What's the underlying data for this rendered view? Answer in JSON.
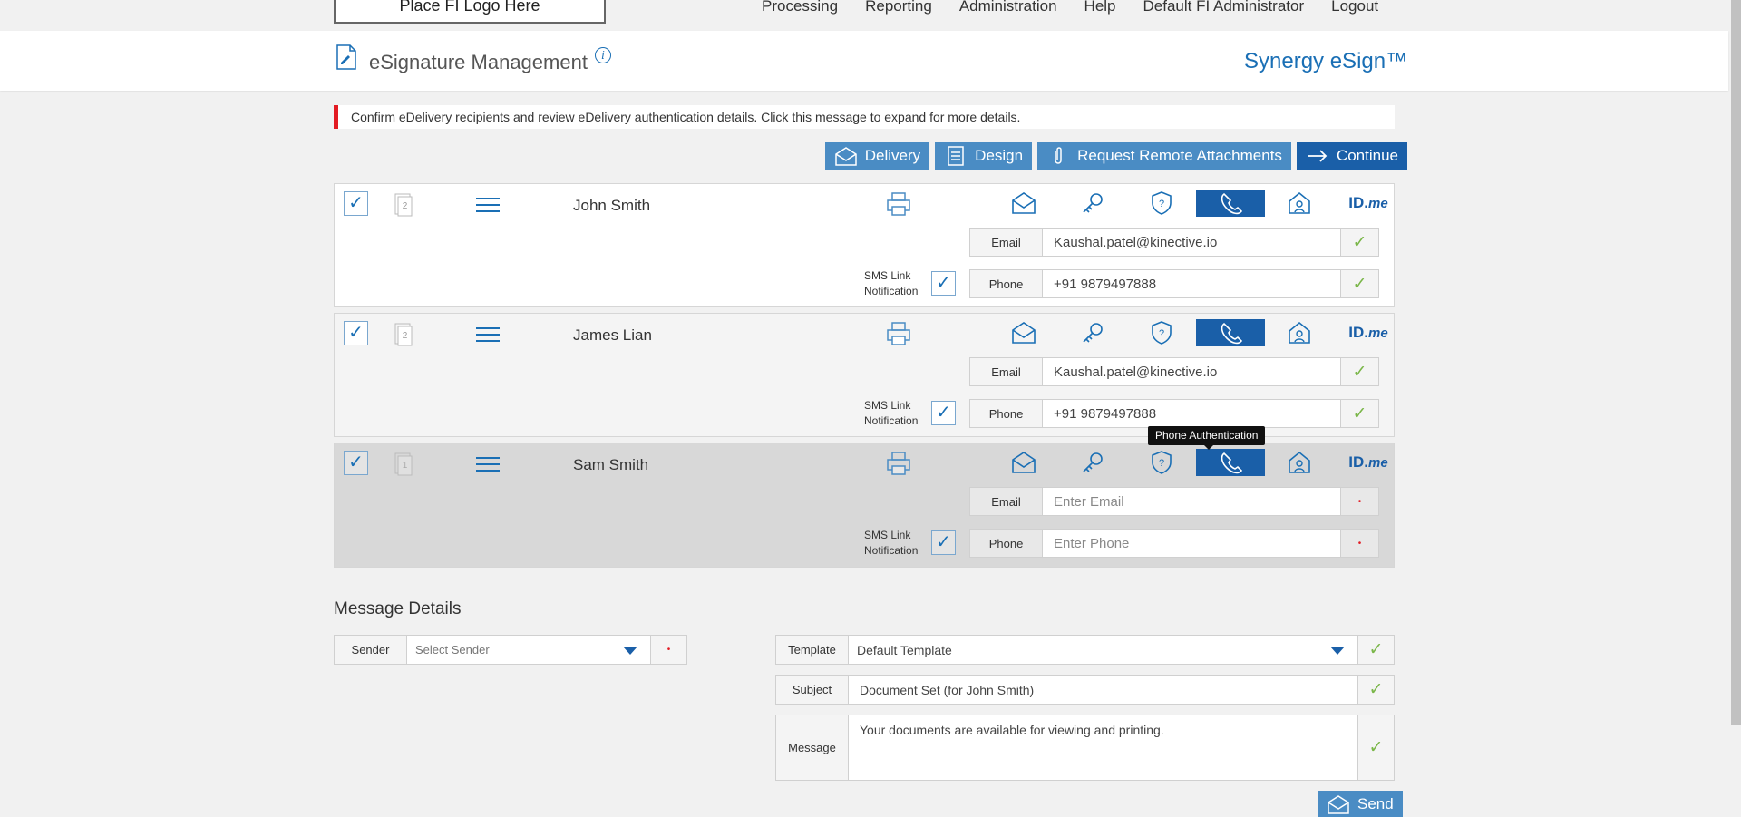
{
  "topbar": {
    "logo_text": "Place FI Logo Here",
    "nav": [
      "Processing",
      "Reporting",
      "Administration",
      "Help",
      "Default FI Administrator",
      "Logout"
    ]
  },
  "header": {
    "title": "eSignature Management",
    "info": "i",
    "brand": "Synergy eSign™"
  },
  "alert": {
    "text": "Confirm eDelivery recipients and review eDelivery authentication details. Click this message to expand for more details."
  },
  "actions": {
    "delivery": "Delivery",
    "design": "Design",
    "remote": "Request Remote Attachments",
    "continue": "Continue"
  },
  "recipients": [
    {
      "name": "John Smith",
      "page": "2",
      "email": "Kaushal.patel@kinective.io",
      "phone": "+91 9879497888"
    },
    {
      "name": "James Lian",
      "page": "2",
      "email": "Kaushal.patel@kinective.io",
      "phone": "+91 9879497888"
    },
    {
      "name": "Sam Smith",
      "page": "1",
      "email": "",
      "phone": ""
    }
  ],
  "labels": {
    "email": "Email",
    "phone": "Phone",
    "sms_line1": "SMS Link",
    "sms_line2": "Notification",
    "email_placeholder": "Enter Email",
    "phone_placeholder": "Enter Phone",
    "check": "✓",
    "checked": "✓",
    "required": "•",
    "idme_id": "ID.",
    "idme_me": "me"
  },
  "tooltip": "Phone Authentication",
  "message": {
    "title": "Message Details",
    "sender_label": "Sender",
    "sender_placeholder": "Select Sender",
    "template_label": "Template",
    "template_value": "Default Template",
    "subject_label": "Subject",
    "subject_value": "Document Set (for John Smith)",
    "message_label": "Message",
    "message_value": "Your documents are available for viewing and printing.",
    "send": "Send"
  },
  "colors": {
    "primary": "#1a5fa8",
    "button": "#4a8cc4",
    "alert": "#e31b23",
    "check": "#7ab648"
  }
}
